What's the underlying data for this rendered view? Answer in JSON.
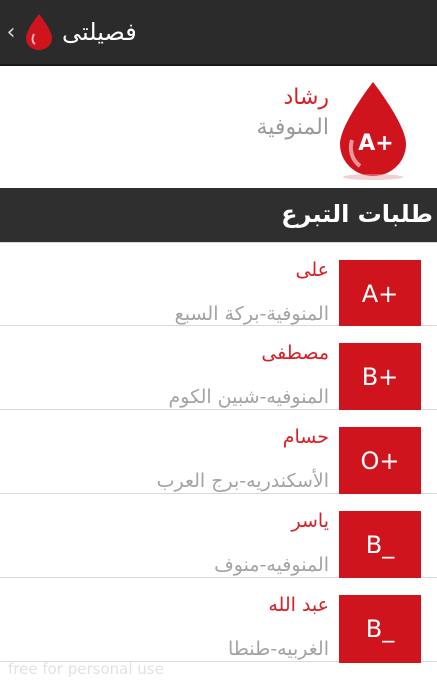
{
  "action_bar": {
    "title": "فصيلتى",
    "back_icon": "chevron-left-icon",
    "logo_icon": "blood-drop-icon"
  },
  "profile": {
    "name": "رشاد",
    "location": "المنوفية",
    "blood_type": "A+",
    "icon": "blood-drop-icon"
  },
  "section": {
    "title": "طلبات التبرع"
  },
  "requests": [
    {
      "name": "على",
      "location": "المنوفية-بركة السبع",
      "blood_type": "A+"
    },
    {
      "name": "مصطفى",
      "location": "المنوفيه-شبين الكوم",
      "blood_type": "B+"
    },
    {
      "name": "حسام",
      "location": "الأسكندريه-برج العرب",
      "blood_type": "O+"
    },
    {
      "name": "ياسر",
      "location": "المنوفيه-منوف",
      "blood_type": "B_"
    },
    {
      "name": "عبد الله",
      "location": "الغربيه-طنطا",
      "blood_type": "B_"
    }
  ],
  "watermark": "free for personal use",
  "colors": {
    "accent": "#d0141e",
    "name_text": "#d81f26",
    "secondary_text": "#a3a3a3",
    "bar_bg": "#2b2b2b"
  }
}
